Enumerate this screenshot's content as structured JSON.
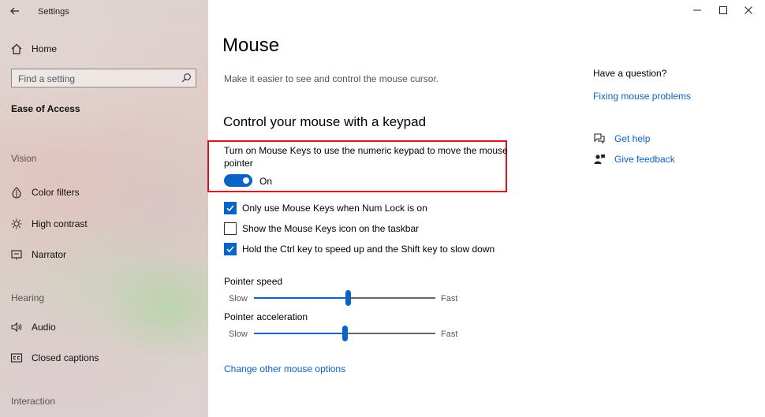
{
  "window": {
    "title": "Settings"
  },
  "sidebar": {
    "home_label": "Home",
    "search_placeholder": "Find a setting",
    "section_title": "Ease of Access",
    "groups": [
      {
        "heading": "Vision"
      },
      {
        "heading": "Hearing"
      },
      {
        "heading": "Interaction"
      }
    ],
    "items": [
      {
        "label": "Color filters",
        "icon": "color-filters-icon"
      },
      {
        "label": "High contrast",
        "icon": "brightness-icon"
      },
      {
        "label": "Narrator",
        "icon": "narrator-icon"
      },
      {
        "label": "Audio",
        "icon": "speaker-icon"
      },
      {
        "label": "Closed captions",
        "icon": "closed-captions-icon"
      }
    ]
  },
  "main": {
    "title": "Mouse",
    "description": "Make it easier to see and control the mouse cursor.",
    "keypad_heading": "Control your mouse with a keypad",
    "mouse_keys_label": "Turn on Mouse Keys to use the numeric keypad to move the mouse pointer",
    "mouse_keys_state": "On",
    "checkboxes": [
      {
        "label": "Only use Mouse Keys when Num Lock is on",
        "checked": true
      },
      {
        "label": "Show the Mouse Keys icon on the taskbar",
        "checked": false
      },
      {
        "label": "Hold the Ctrl key to speed up and the Shift key to slow down",
        "checked": true
      }
    ],
    "pointer_speed": {
      "label": "Pointer speed",
      "min_label": "Slow",
      "max_label": "Fast",
      "value": 0.52
    },
    "pointer_acceleration": {
      "label": "Pointer acceleration",
      "min_label": "Slow",
      "max_label": "Fast",
      "value": 0.5
    },
    "other_options_link": "Change other mouse options"
  },
  "help": {
    "title": "Have a question?",
    "link": "Fixing mouse problems",
    "get_help": "Get help",
    "give_feedback": "Give feedback"
  },
  "colors": {
    "accent": "#0a64c8",
    "highlight_border": "#d9141b"
  }
}
